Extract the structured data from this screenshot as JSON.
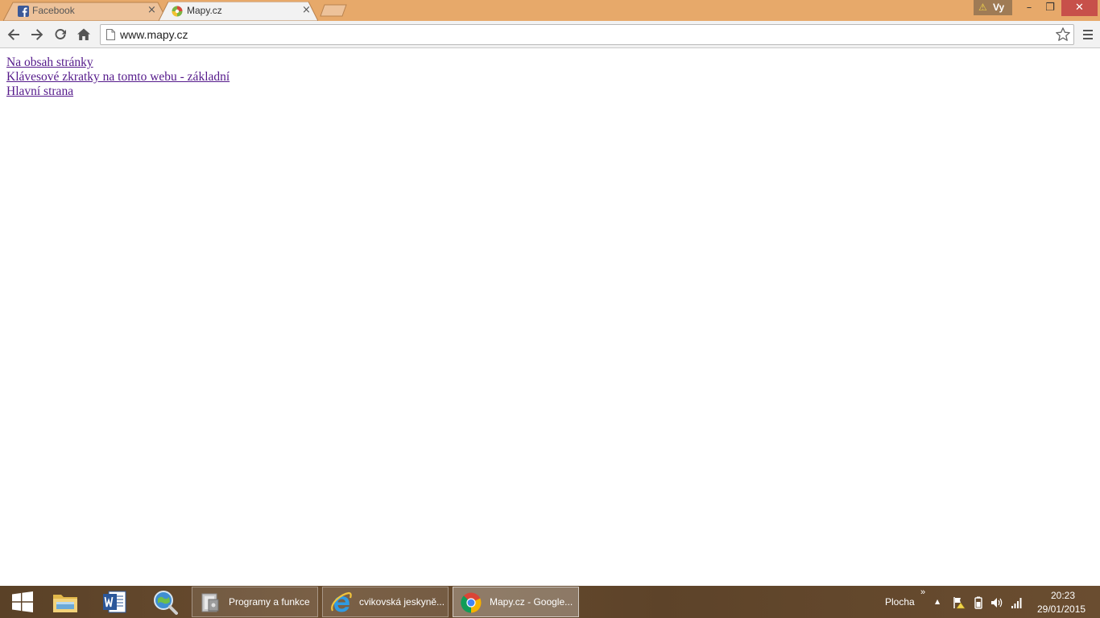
{
  "browser": {
    "tabs": [
      {
        "title": "Facebook",
        "active": false,
        "close": "×"
      },
      {
        "title": "Mapy.cz",
        "active": true,
        "close": "×"
      }
    ],
    "profile": {
      "warning": "⚠",
      "name": "Vy"
    },
    "window_controls": {
      "minimize": "–",
      "restore": "❐",
      "close": "✕"
    },
    "address": "www.mapy.cz"
  },
  "page": {
    "links": [
      "Na obsah stránky",
      "Klávesové zkratky na tomto webu - základní",
      "Hlavní strana"
    ]
  },
  "taskbar": {
    "tasks": [
      {
        "label": "Programy a funkce"
      },
      {
        "label": "cvikovská jeskyně..."
      },
      {
        "label": "Mapy.cz - Google..."
      }
    ],
    "toolbar_label": "Plocha",
    "toolbar_chevron": "»",
    "tray_up": "▲",
    "time": "20:23",
    "date": "29/01/2015"
  },
  "colors": {
    "titlebar": "#e7a96a",
    "link_visited": "#551a8b",
    "taskbar": "#5f452b"
  }
}
